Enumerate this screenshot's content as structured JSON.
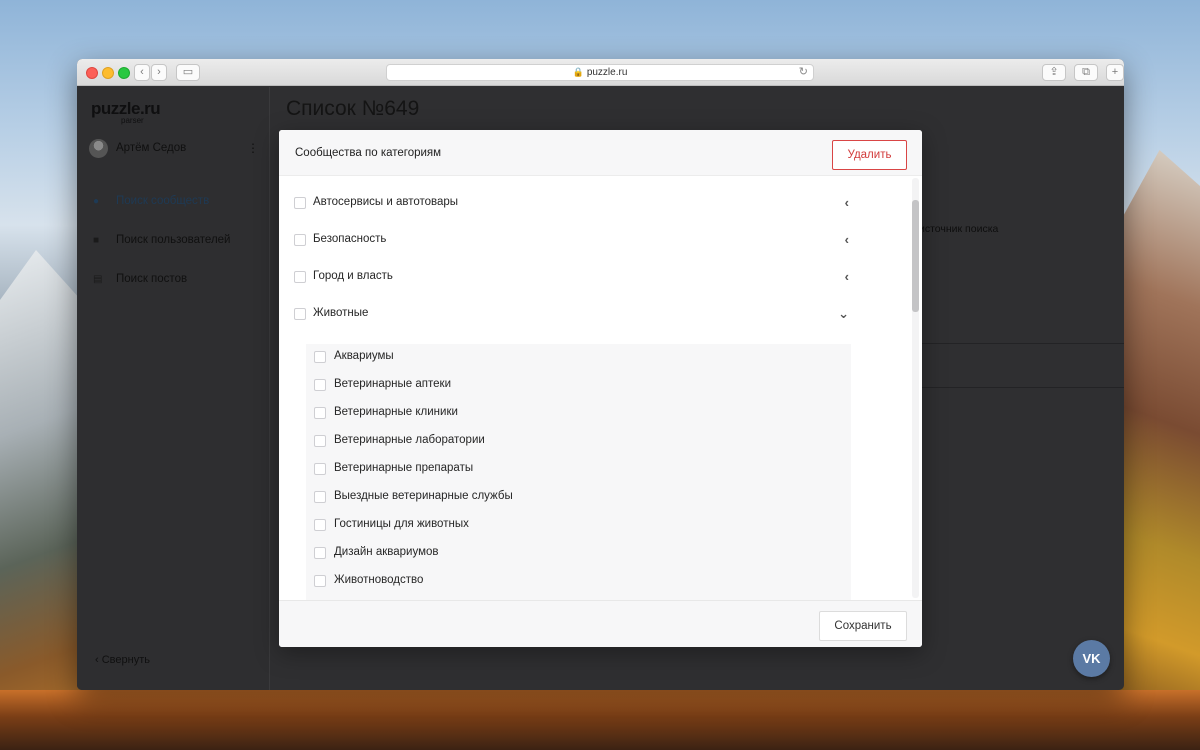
{
  "browser": {
    "url": "puzzle.ru"
  },
  "sidebar": {
    "logo": "puzzle.ru",
    "logo_sub": "parser",
    "user_name": "Артём Седов",
    "menu_glyph": "⋮",
    "items": [
      {
        "label": "Поиск  сообществ",
        "icon": "chat-icon",
        "active": true
      },
      {
        "label": "Поиск  пользователей",
        "icon": "users-icon",
        "active": false
      },
      {
        "label": "Поиск  постов",
        "icon": "posts-icon",
        "active": false
      }
    ],
    "collapse_label": "Свернуть"
  },
  "page": {
    "title": "Список №649",
    "bg_text": "источник поиска"
  },
  "modal": {
    "title": "Сообщества по категориям",
    "delete_label": "Удалить",
    "save_label": "Сохранить",
    "categories": [
      {
        "label": "Автосервисы и автотовары",
        "expanded": false
      },
      {
        "label": "Безопасность",
        "expanded": false
      },
      {
        "label": "Город и власть",
        "expanded": false
      },
      {
        "label": "Животные",
        "expanded": true
      }
    ],
    "subcategories": [
      "Аквариумы",
      "Ветеринарные аптеки",
      "Ветеринарные клиники",
      "Ветеринарные лаборатории",
      "Ветеринарные препараты",
      "Выездные ветеринарные службы",
      "Гостиницы для животных",
      "Дизайн аквариумов",
      "Животноводство"
    ]
  },
  "vk_button": {
    "label": "VK"
  },
  "colors": {
    "accent_red": "#d23b3b",
    "vk_blue": "#5b7aa4",
    "overlay": "#2f2f31"
  }
}
